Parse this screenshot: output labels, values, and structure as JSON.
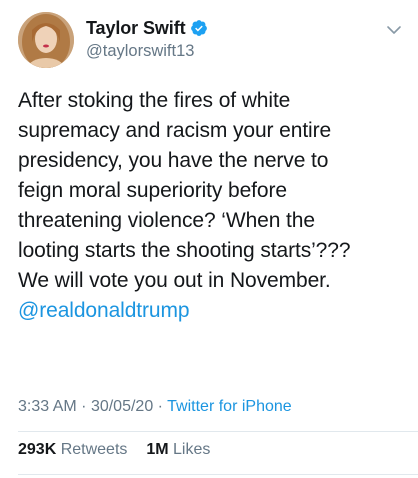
{
  "author": {
    "display_name": "Taylor Swift",
    "handle": "@taylorswift13",
    "verified": true,
    "verified_color": "#1da1f2"
  },
  "tweet": {
    "lines": [
      "After stoking the fires of white",
      "supremacy and racism your entire",
      "presidency, you have the nerve to",
      "feign moral superiority before",
      "threatening violence? ‘When the",
      "looting starts the shooting starts’???",
      "We will vote you out in November."
    ],
    "mention": "@realdonaldtrump",
    "time": "3:33 AM",
    "separator": "·",
    "date": "30/05/20",
    "source": "Twitter for iPhone"
  },
  "stats": {
    "retweets_count": "293K",
    "retweets_label": "Retweets",
    "likes_count": "1M",
    "likes_label": "Likes"
  },
  "icons": {
    "verified": "verified-badge-icon",
    "menu": "chevron-down-icon"
  },
  "colors": {
    "link": "#1b95e0",
    "secondary_text": "#657786",
    "primary_text": "#14171a"
  }
}
